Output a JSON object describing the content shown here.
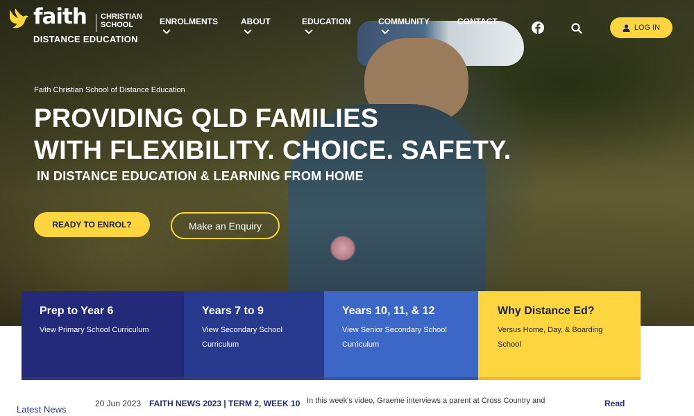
{
  "brand": {
    "wordmark": "faith",
    "sub_line1": "CHRISTIAN",
    "sub_line2": "SCHOOL",
    "distance": "DISTANCE EDUCATION"
  },
  "nav": {
    "items": [
      {
        "label": "ENROLMENTS"
      },
      {
        "label": "ABOUT"
      },
      {
        "label": "EDUCATION"
      },
      {
        "label": "COMMUNITY"
      },
      {
        "label": "CONTACT"
      }
    ],
    "facebook_icon": "facebook-icon",
    "search_icon": "search-icon",
    "login_label": "LOG IN"
  },
  "hero": {
    "eyebrow": "Faith Christian School of Distance Education",
    "headline_line1": "PROVIDING QLD FAMILIES",
    "headline_line2": "WITH FLEXIBILITY. CHOICE. SAFETY.",
    "subhead": "IN DISTANCE EDUCATION & LEARNING FROM HOME",
    "cta_primary": "READY TO ENROL?",
    "cta_secondary": "Make an Enquiry"
  },
  "cards": [
    {
      "title": "Prep to Year 6",
      "link_line1": "View Primary School Curriculum",
      "link_line2": ""
    },
    {
      "title": "Years 7 to 9",
      "link_line1": "View Secondary School",
      "link_line2": "Curriculum"
    },
    {
      "title": "Years 10, 11, & 12",
      "link_line1": "View Senior Secondary School",
      "link_line2": "Curriculum"
    },
    {
      "title": "Why Distance Ed?",
      "link_line1": "Versus Home, Day, & Boarding School",
      "link_line2": ""
    }
  ],
  "news": {
    "label": "Latest News",
    "date": "20 Jun 2023",
    "title": "FAITH NEWS 2023 | TERM 2, WEEK 10",
    "excerpt": "In this week’s video, Graeme interviews a parent at Cross Country and",
    "read": "Read"
  },
  "colors": {
    "accent_yellow": "#fcd53f",
    "navy": "#232a7a",
    "blue": "#283a8e",
    "light_blue": "#3c67c7"
  }
}
